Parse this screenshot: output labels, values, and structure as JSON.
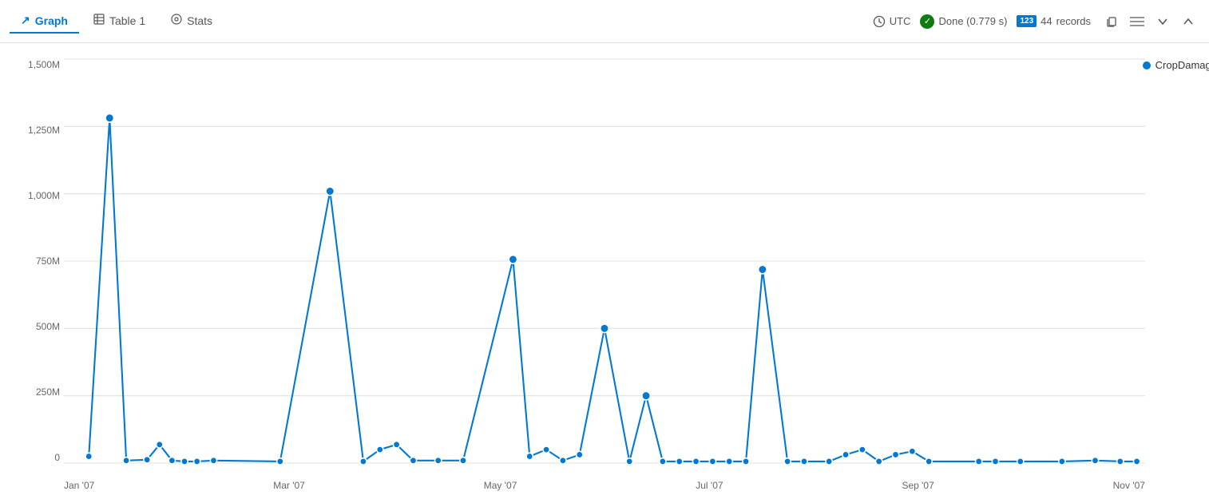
{
  "header": {
    "tabs": [
      {
        "id": "graph",
        "label": "Graph",
        "icon": "📈",
        "active": true
      },
      {
        "id": "table1",
        "label": "Table 1",
        "icon": "⊞",
        "active": false
      },
      {
        "id": "stats",
        "label": "Stats",
        "icon": "◎",
        "active": false
      }
    ],
    "status_utc": "UTC",
    "status_done": "Done (0.779 s)",
    "records_count": "44",
    "records_label": "records",
    "records_badge": "123"
  },
  "chart": {
    "legend_label": "CropDamage",
    "y_labels": [
      "1,500M",
      "1,250M",
      "1,000M",
      "750M",
      "500M",
      "250M",
      "0"
    ],
    "x_labels": [
      "Jan '07",
      "Mar '07",
      "May '07",
      "Jul '07",
      "Sep '07",
      "Nov '07"
    ]
  }
}
